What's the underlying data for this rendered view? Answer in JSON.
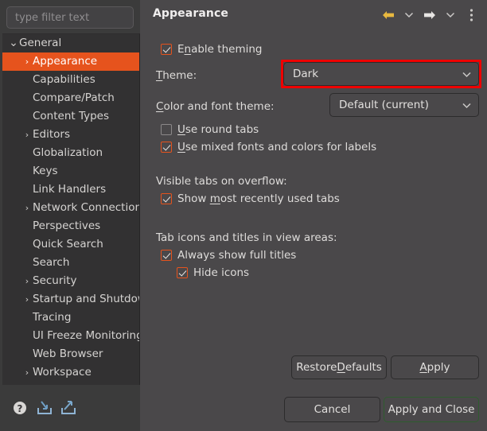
{
  "sidebar": {
    "filter": {
      "value": "",
      "placeholder": "type filter text"
    },
    "items": [
      {
        "label": "General",
        "level": 0,
        "twisty": "expanded",
        "selected": false
      },
      {
        "label": "Appearance",
        "level": 1,
        "twisty": "collapsed",
        "selected": true
      },
      {
        "label": "Capabilities",
        "level": 1,
        "twisty": "none",
        "selected": false
      },
      {
        "label": "Compare/Patch",
        "level": 1,
        "twisty": "none",
        "selected": false
      },
      {
        "label": "Content Types",
        "level": 1,
        "twisty": "none",
        "selected": false
      },
      {
        "label": "Editors",
        "level": 1,
        "twisty": "collapsed",
        "selected": false
      },
      {
        "label": "Globalization",
        "level": 1,
        "twisty": "none",
        "selected": false
      },
      {
        "label": "Keys",
        "level": 1,
        "twisty": "none",
        "selected": false
      },
      {
        "label": "Link Handlers",
        "level": 1,
        "twisty": "none",
        "selected": false
      },
      {
        "label": "Network Connections",
        "level": 1,
        "twisty": "collapsed",
        "selected": false
      },
      {
        "label": "Perspectives",
        "level": 1,
        "twisty": "none",
        "selected": false
      },
      {
        "label": "Quick Search",
        "level": 1,
        "twisty": "none",
        "selected": false
      },
      {
        "label": "Search",
        "level": 1,
        "twisty": "none",
        "selected": false
      },
      {
        "label": "Security",
        "level": 1,
        "twisty": "collapsed",
        "selected": false
      },
      {
        "label": "Startup and Shutdown",
        "level": 1,
        "twisty": "collapsed",
        "selected": false
      },
      {
        "label": "Tracing",
        "level": 1,
        "twisty": "none",
        "selected": false
      },
      {
        "label": "UI Freeze Monitoring",
        "level": 1,
        "twisty": "none",
        "selected": false
      },
      {
        "label": "Web Browser",
        "level": 1,
        "twisty": "none",
        "selected": false
      },
      {
        "label": "Workspace",
        "level": 1,
        "twisty": "collapsed",
        "selected": false
      }
    ],
    "icon_strip": [
      {
        "name": "help-icon",
        "title": "Help"
      },
      {
        "name": "import-icon",
        "title": "Import preferences"
      },
      {
        "name": "export-icon",
        "title": "Export preferences"
      }
    ]
  },
  "header": {
    "title": "Appearance",
    "tools": [
      {
        "name": "back-arrow-icon",
        "title": "Back"
      },
      {
        "name": "back-dropdown-icon",
        "title": "Back history"
      },
      {
        "name": "forward-arrow-icon",
        "title": "Forward"
      },
      {
        "name": "forward-dropdown-icon",
        "title": "Forward history"
      },
      {
        "name": "overflow-menu-icon",
        "title": "View menu"
      }
    ]
  },
  "content": {
    "enable_theming": {
      "label_pre": "E",
      "label_mn": "n",
      "label_post": "able theming",
      "checked": true
    },
    "theme": {
      "label_mn": "T",
      "label_post": "heme:",
      "value": "Dark",
      "highlighted": true
    },
    "color_font_theme": {
      "label_mn": "C",
      "label_post": "olor and font theme:",
      "value": "Default (current)"
    },
    "use_round_tabs": {
      "label_mn": "U",
      "label_post": "se round tabs",
      "checked": false
    },
    "use_mixed_fonts": {
      "label_mn": "U",
      "label_post": "se mixed fonts and colors for labels",
      "checked": true
    },
    "visible_tabs_heading": "Visible tabs on overflow:",
    "show_mru_tabs": {
      "label_pre": "Show ",
      "label_mn": "m",
      "label_post": "ost recently used tabs",
      "checked": true
    },
    "tab_icons_heading": "Tab icons and titles in view areas:",
    "always_show_full_titles": {
      "label_pre": "",
      "label_mn": "",
      "label_post": "Always show full titles",
      "checked": true
    },
    "hide_icons": {
      "label_pre": "",
      "label_mn": "",
      "label_post": "Hide icons",
      "checked": true
    }
  },
  "buttons": {
    "restore_defaults": {
      "pre": "Restore ",
      "mn": "D",
      "post": "efaults"
    },
    "apply": {
      "pre": "",
      "mn": "A",
      "post": "pply"
    },
    "cancel": {
      "pre": "Cancel",
      "mn": "",
      "post": ""
    },
    "apply_and_close": {
      "pre": "Apply and Close",
      "mn": "",
      "post": "",
      "is_default": true
    }
  },
  "colors": {
    "accent_orange": "#e6531d",
    "highlight_red": "#ee0000",
    "panel_bg": "#4a484a",
    "sidebar_bg": "#3b3b3b",
    "tree_bg": "#323132",
    "text": "#dedcda",
    "back_arrow": "#e8b83f",
    "forward_arrow": "#e6e4e2",
    "default_button_border": "#2e5c2e"
  }
}
